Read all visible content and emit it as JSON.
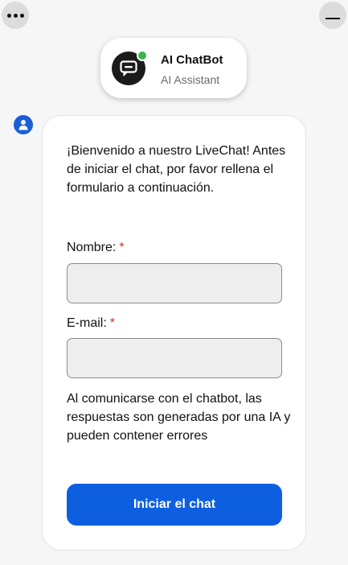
{
  "window": {
    "menu_icon": "more-horizontal-icon",
    "minimize_icon": "minimize-icon"
  },
  "agent": {
    "name": "AI ChatBot",
    "role": "AI Assistant",
    "avatar_icon": "chatbot-icon",
    "status": "online",
    "status_color": "#3bb54a"
  },
  "user": {
    "avatar_icon": "user-icon",
    "avatar_color": "#1a5fd6"
  },
  "form": {
    "intro": "¡Bienvenido a nuestro LiveChat! Antes de iniciar el chat, por favor rellena el formulario a continuación.",
    "required_mark": "*",
    "name_label": "Nombre:",
    "name_value": "",
    "email_label": "E-mail:",
    "email_value": "",
    "disclaimer": "Al comunicarse con el chatbot, las respuestas son generadas por una IA y pueden contener errores",
    "submit_label": "Iniciar el chat",
    "accent_color": "#0d5fe0"
  }
}
